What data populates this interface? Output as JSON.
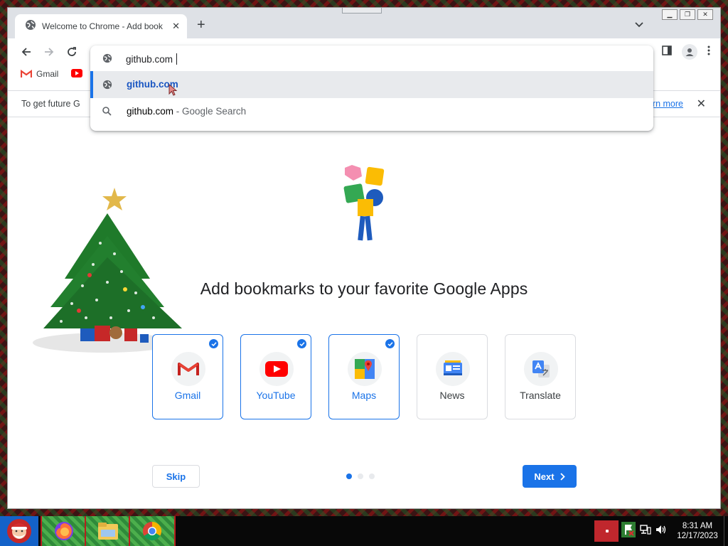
{
  "browser": {
    "tab_title": "Welcome to Chrome - Add book",
    "new_tab_symbol": "+",
    "window_controls": [
      "minimize",
      "restore",
      "close"
    ]
  },
  "omnibox": {
    "value": "github.com",
    "suggestions": [
      {
        "text": "github.com",
        "suffix": "",
        "icon": "globe-icon",
        "selected": true
      },
      {
        "text": "github.com",
        "suffix": " - Google Search",
        "icon": "search-icon",
        "selected": false
      }
    ]
  },
  "bookmarks_bar": {
    "items": [
      {
        "label": "Gmail",
        "icon": "gmail-icon"
      }
    ]
  },
  "infobar": {
    "text": "To get future G",
    "link": "earn more",
    "close_symbol": "✕"
  },
  "page": {
    "heading": "Add bookmarks to your favorite Google Apps",
    "apps": [
      {
        "label": "Gmail",
        "selected": true
      },
      {
        "label": "YouTube",
        "selected": true
      },
      {
        "label": "Maps",
        "selected": true
      },
      {
        "label": "News",
        "selected": false
      },
      {
        "label": "Translate",
        "selected": false
      }
    ],
    "skip_label": "Skip",
    "next_label": "Next",
    "step_current": 1,
    "step_total": 3
  },
  "taskbar": {
    "apps": [
      "firefox",
      "file-explorer",
      "chrome"
    ],
    "clock_time": "8:31 AM",
    "clock_date": "12/17/2023"
  },
  "colors": {
    "accent": "#1a73e8",
    "titlebar": "#dee1e6",
    "selected_row": "#e8eaed"
  }
}
